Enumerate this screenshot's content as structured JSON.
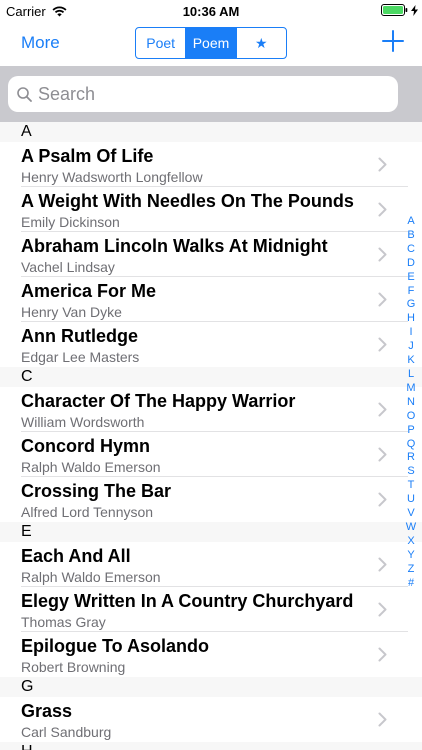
{
  "status": {
    "carrier": "Carrier",
    "time": "10:36 AM"
  },
  "nav": {
    "more_label": "More",
    "segments": [
      {
        "label": "Poet",
        "selected": false
      },
      {
        "label": "Poem",
        "selected": true
      },
      {
        "label": "★",
        "selected": false
      }
    ],
    "add_icon": "plus-icon"
  },
  "search": {
    "placeholder": "Search",
    "value": ""
  },
  "sections": [
    {
      "header": "A",
      "rows": [
        {
          "title": "A Psalm Of Life",
          "author": "Henry Wadsworth Longfellow"
        },
        {
          "title": "A Weight With Needles On The Pounds",
          "author": "Emily Dickinson"
        },
        {
          "title": "Abraham Lincoln Walks At Midnight",
          "author": "Vachel Lindsay"
        },
        {
          "title": "America For Me",
          "author": "Henry Van Dyke"
        },
        {
          "title": "Ann Rutledge",
          "author": "Edgar Lee Masters"
        }
      ]
    },
    {
      "header": "C",
      "rows": [
        {
          "title": "Character Of The Happy Warrior",
          "author": "William Wordsworth"
        },
        {
          "title": "Concord Hymn",
          "author": "Ralph Waldo Emerson"
        },
        {
          "title": "Crossing The Bar",
          "author": "Alfred Lord Tennyson"
        }
      ]
    },
    {
      "header": "E",
      "rows": [
        {
          "title": "Each And All",
          "author": "Ralph Waldo Emerson"
        },
        {
          "title": "Elegy Written In A Country Churchyard",
          "author": "Thomas Gray"
        },
        {
          "title": "Epilogue To Asolando",
          "author": "Robert Browning"
        }
      ]
    },
    {
      "header": "G",
      "rows": [
        {
          "title": "Grass",
          "author": "Carl Sandburg"
        }
      ]
    },
    {
      "header": "H",
      "rows": []
    }
  ],
  "index_letters": [
    "A",
    "B",
    "C",
    "D",
    "E",
    "F",
    "G",
    "H",
    "I",
    "J",
    "K",
    "L",
    "M",
    "N",
    "O",
    "P",
    "Q",
    "R",
    "S",
    "T",
    "U",
    "V",
    "W",
    "X",
    "Y",
    "Z",
    "#"
  ],
  "colors": {
    "accent": "#1a7ef7",
    "search_bar_bg": "#c9c9ce",
    "section_bg": "#f7f7f7"
  }
}
